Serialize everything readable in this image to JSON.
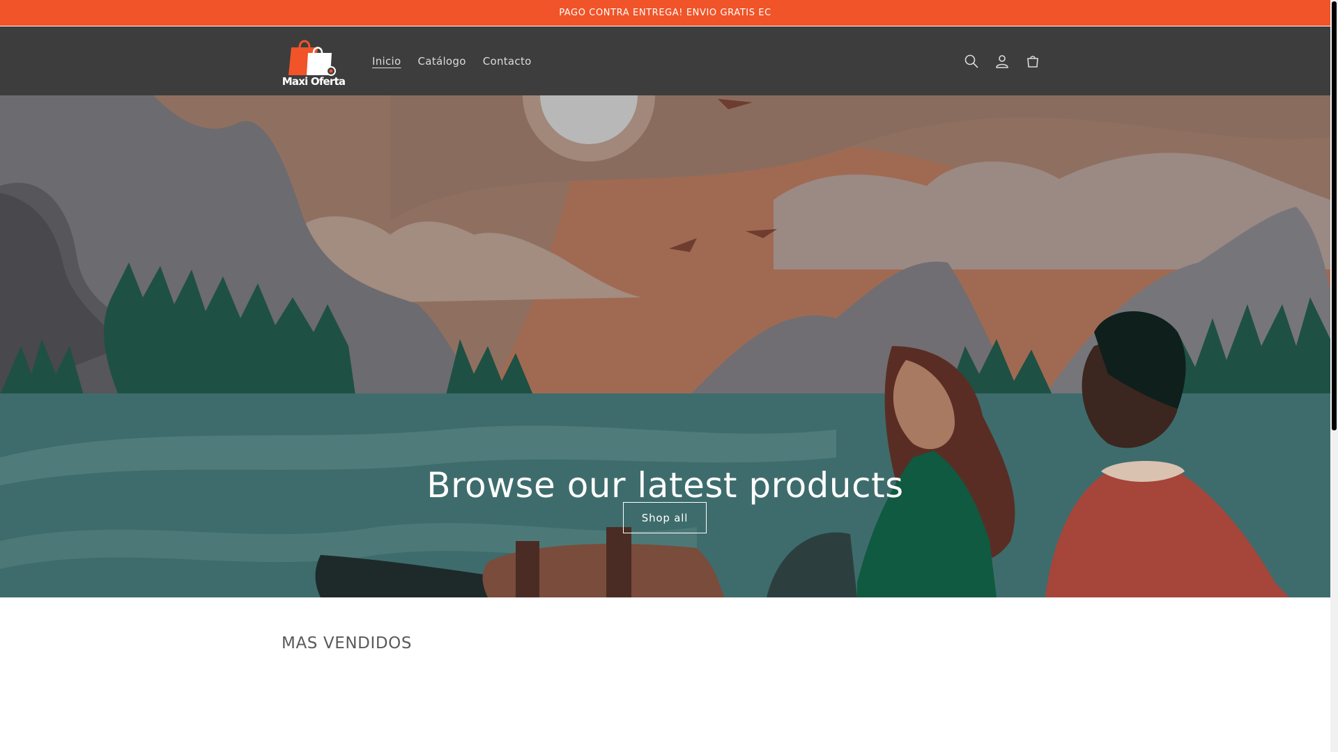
{
  "announcement": {
    "text": "PAGO CONTRA ENTREGA! ENVIO GRATIS EC"
  },
  "header": {
    "logo": {
      "text": "Maxi Oferta",
      "brand_color": "#f05428"
    },
    "nav": [
      {
        "label": "Inicio",
        "active": true
      },
      {
        "label": "Catálogo",
        "active": false
      },
      {
        "label": "Contacto",
        "active": false
      }
    ],
    "icons": [
      "search-icon",
      "account-icon",
      "cart-icon"
    ],
    "background": "#3d3d3d"
  },
  "hero": {
    "title": "Browse our latest products",
    "button_label": "Shop all"
  },
  "featured": {
    "title": "MAS VENDIDOS"
  }
}
